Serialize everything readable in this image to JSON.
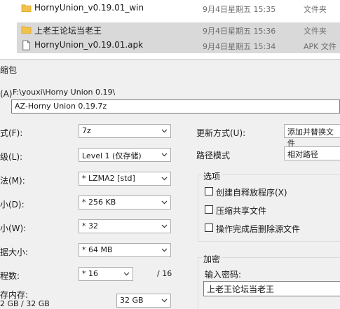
{
  "files": [
    {
      "name": "HornyUnion_v0.19.01_win",
      "date": "9月4日星期五 15:35",
      "type": "文件夹",
      "icon": "folder-icon",
      "selected": false
    },
    {
      "name": "上老王论坛当老王",
      "date": "9月4日星期五 15:36",
      "type": "文件夹",
      "icon": "folder-icon",
      "selected": true
    },
    {
      "name": "HornyUnion_v0.19.01.apk",
      "date": "9月4日星期五 15:34",
      "type": "APK 文件",
      "icon": "file-icon",
      "selected": true
    }
  ],
  "dialog": {
    "title": "缩包",
    "archive": {
      "label": "(A)",
      "path": "F:\\youxi\\Horny Union 0.19\\",
      "name": "AZ-Horny Union 0.19.7z"
    },
    "fields": {
      "format": {
        "label": "式(F):",
        "value": "7z"
      },
      "level": {
        "label": "级(L):",
        "value": "Level 1 (仅存储)"
      },
      "method": {
        "label": "法(M):",
        "value": "* LZMA2 [std]"
      },
      "dict": {
        "label": "小(D):",
        "value": "* 256 KB"
      },
      "word": {
        "label": "小(W):",
        "value": "* 32"
      },
      "solid": {
        "label": "据大小:",
        "value": "* 64 MB"
      },
      "threads": {
        "label": "程数:",
        "value": "* 16",
        "suffix": "/ 16"
      },
      "memory": {
        "label": "存内存:",
        "value": "32 GB",
        "sub": "2 GB / 32 GB"
      }
    },
    "update": {
      "label": "更新方式(U):",
      "value": "添加并替换文件"
    },
    "pathmode": {
      "label": "路径模式",
      "value": "相对路径"
    },
    "options": {
      "title": "选项",
      "items": [
        {
          "label": "创建自释放程序(X)",
          "checked": false
        },
        {
          "label": "压缩共享文件",
          "checked": false
        },
        {
          "label": "操作完成后删除源文件",
          "checked": false
        }
      ]
    },
    "encryption": {
      "title": "加密",
      "password_label": "输入密码:",
      "password_value": "上老王论坛当老王"
    }
  }
}
